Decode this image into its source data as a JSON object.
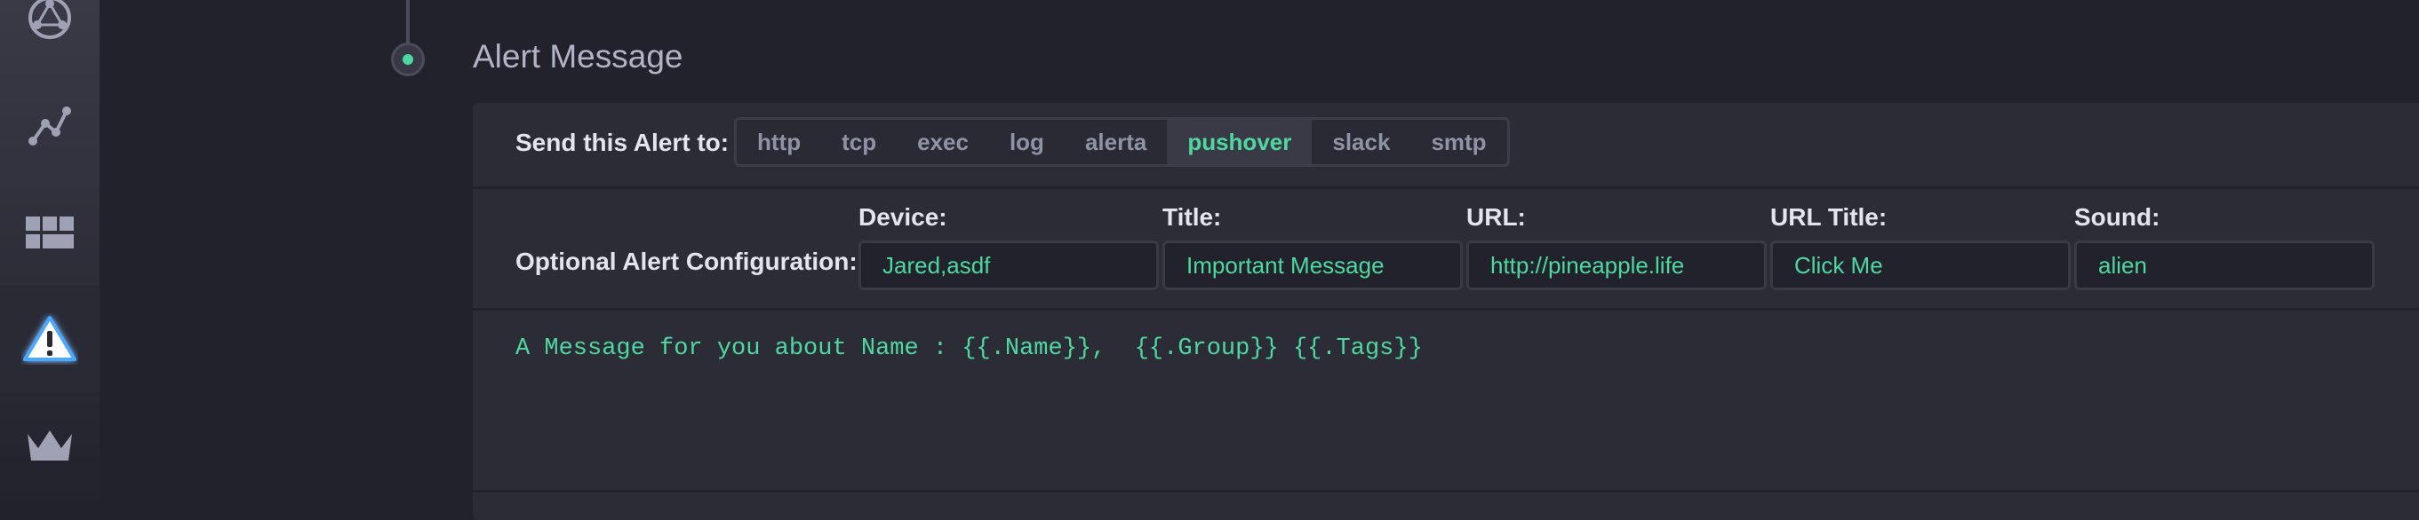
{
  "section": {
    "title": "Alert Message"
  },
  "send_alert": {
    "label": "Send this Alert to:",
    "tabs": [
      {
        "label": "http"
      },
      {
        "label": "tcp"
      },
      {
        "label": "exec"
      },
      {
        "label": "log"
      },
      {
        "label": "alerta"
      },
      {
        "label": "pushover",
        "active": true
      },
      {
        "label": "slack"
      },
      {
        "label": "smtp"
      }
    ]
  },
  "config": {
    "label": "Optional Alert Configuration:",
    "fields": [
      {
        "label": "Device:",
        "value": "Jared,asdf"
      },
      {
        "label": "Title:",
        "value": "Important Message"
      },
      {
        "label": "URL:",
        "value": "http://pineapple.life"
      },
      {
        "label": "URL Title:",
        "value": "Click Me"
      },
      {
        "label": "Sound:",
        "value": "alien"
      }
    ]
  },
  "message": {
    "text": "A Message for you about Name : {{.Name}},  {{.Group}} {{.Tags}}"
  },
  "sidebar": {
    "icons": [
      "network-graph-icon",
      "data-explorer-icon",
      "dashboards-icon",
      "alert-icon",
      "crown-icon"
    ],
    "active": "alert-icon"
  },
  "colors": {
    "accent": "#4ed8a0",
    "background": "#22222c",
    "panel": "#2c2c37",
    "alert_glow": "#4aa8ff"
  }
}
